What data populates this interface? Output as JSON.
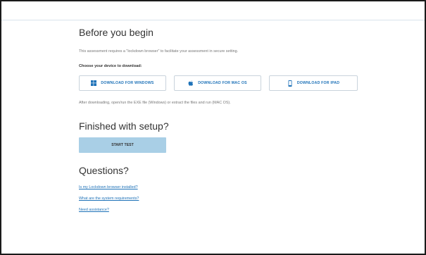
{
  "before": {
    "title": "Before you begin",
    "intro": "This assessment requires a \"lockdown browser\" to facilitate your assessment in secure setting.",
    "choose_label": "Choose your device to download:"
  },
  "downloads": [
    {
      "label": "DOWNLOAD FOR WINDOWS",
      "icon": "windows-icon"
    },
    {
      "label": "DOWNLOAD FOR MAC OS",
      "icon": "apple-icon"
    },
    {
      "label": "DOWNLOAD FOR IPAD",
      "icon": "tablet-icon"
    }
  ],
  "after_text": "After downloading, open/run the EXE file (Windows) or extract the files and run (MAC OS).",
  "setup": {
    "title": "Finished with setup?",
    "start_label": "START TEST"
  },
  "questions": {
    "title": "Questions?",
    "links": [
      "Is my Lockdown browser installed?",
      "What are the system requirements?",
      "Need assistance?"
    ]
  },
  "colors": {
    "accent": "#1e72b8",
    "start_button": "#a9cfe6",
    "heading": "#333333",
    "muted": "#777777"
  }
}
